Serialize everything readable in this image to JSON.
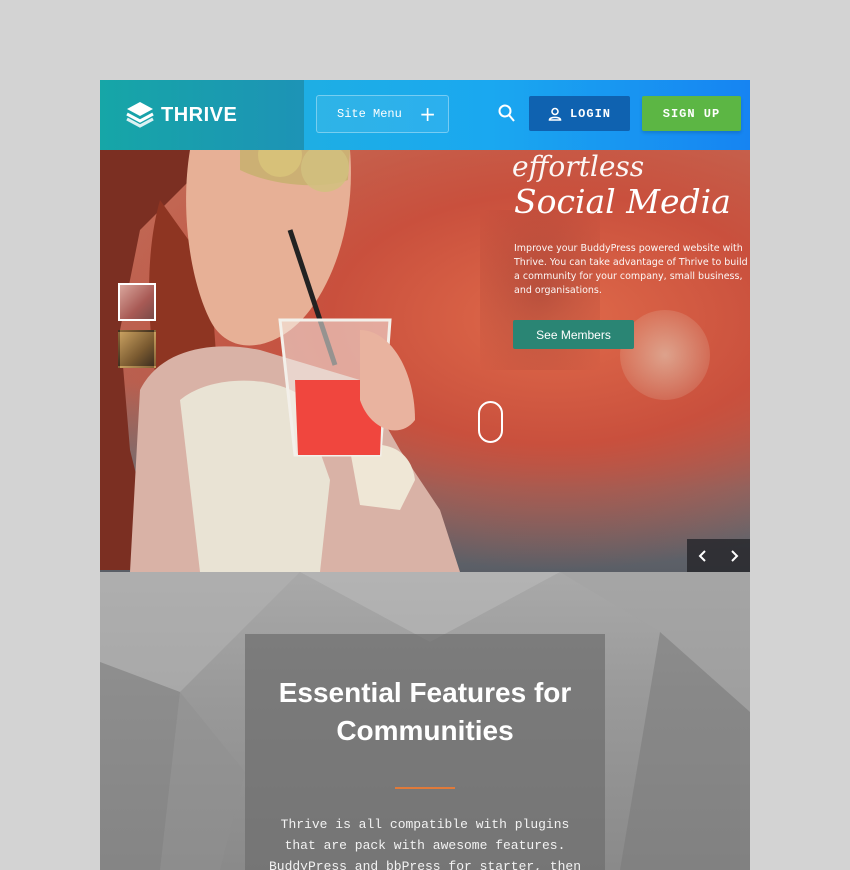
{
  "header": {
    "brand_name": "THRIVE",
    "site_menu_label": "Site Menu",
    "login_label": "LOGIN",
    "signup_label": "SIGN UP",
    "icons": [
      "thrive-logo-icon",
      "plus-icon",
      "search-icon",
      "user-icon"
    ]
  },
  "hero": {
    "script_line1": "effortless",
    "script_line2": "Social Media",
    "description": "Improve your BuddyPress powered website with Thrive. You can take advantage of Thrive to build a community for your company, small business, and organisations.",
    "cta_label": "See Members",
    "icons": [
      "chevron-left-icon",
      "chevron-right-icon"
    ]
  },
  "features": {
    "title": "Essential Features for\nCommunities",
    "text": "Thrive is all compatible with plugins\nthat are pack with awesome features.\nBuddyPress and bbPress for starter, then"
  },
  "colors": {
    "brand_teal": "#16a6a7",
    "header_blue": "#1aa8f0",
    "login_blue": "#0f62b0",
    "signup_green": "#5cb644",
    "cta_green": "#2a8574",
    "accent_orange": "#e07a3a"
  }
}
